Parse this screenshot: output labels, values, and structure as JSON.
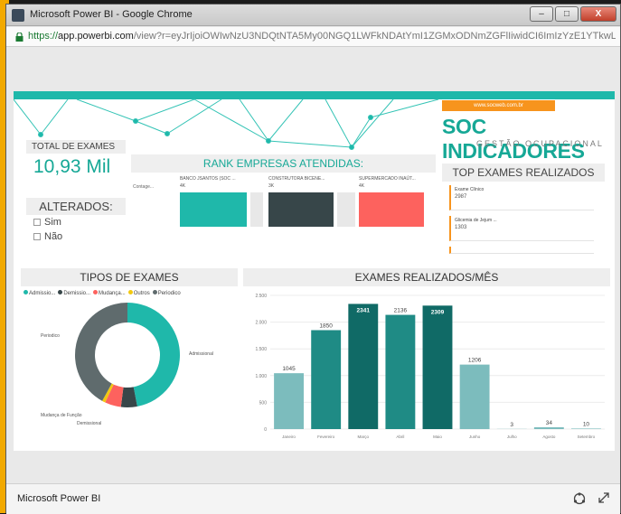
{
  "window": {
    "title": "Microsoft Power BI - Google Chrome",
    "min": "–",
    "max": "□",
    "close": "X"
  },
  "address": {
    "scheme": "https://",
    "host": "app.powerbi.com",
    "rest": "/view?r=eyJrIjoiOWIwNzU3NDQtNTA5My00NGQ1LWFkNDAtYmI1ZGMxODNmZGFlIiwidCI6ImIzYzE1YTkwLTI"
  },
  "brand": {
    "logo_text": "www.socweb.com.br",
    "title": "SOC INDICADORES",
    "subtitle": "GESTÃO OCUPACIONAL"
  },
  "total_exames": {
    "label": "TOTAL DE EXAMES",
    "value": "10,93 Mil"
  },
  "alterados": {
    "label": "ALTERADOS:",
    "options": [
      "Sim",
      "Não"
    ]
  },
  "rank": {
    "title": "RANK EMPRESAS ATENDIDAS:",
    "row_label": "Contage...",
    "companies": [
      {
        "name": "BANCO JSANTOS (SOC ...",
        "value": "4K"
      },
      {
        "name": "CONSTRUTORA BICENE...",
        "value": "3K"
      },
      {
        "name": "SUPERMERCADO INAÚT...",
        "value": "4K"
      }
    ]
  },
  "top_exames": {
    "title": "TOP EXAMES REALIZADOS",
    "items": [
      {
        "name": "Exame Clínico",
        "count": "2987"
      },
      {
        "name": "Glicemia de Jejum ...",
        "count": "1303"
      }
    ]
  },
  "tipos": {
    "title": "TIPOS DE EXAMES",
    "legend": [
      {
        "label": "Admissio...",
        "color": "#1fb8aa"
      },
      {
        "label": "Demissio...",
        "color": "#374649"
      },
      {
        "label": "Mudança...",
        "color": "#fd625e"
      },
      {
        "label": "Outros",
        "color": "#f2c80f"
      },
      {
        "label": "Periodico",
        "color": "#5f6b6d"
      }
    ],
    "slice_labels": {
      "admissional": "Admissional",
      "periodico": "Periodico",
      "mudanca": "Mudança de Função",
      "demissional": "Demissional"
    }
  },
  "chart_data": [
    {
      "type": "pie",
      "title": "TIPOS DE EXAMES",
      "categories": [
        "Admissional",
        "Demissional",
        "Mudança de Função",
        "Outros",
        "Periodico"
      ],
      "values": [
        47,
        5,
        5,
        1,
        42
      ],
      "colors": [
        "#1fb8aa",
        "#374649",
        "#fd625e",
        "#f2c80f",
        "#5f6b6d"
      ]
    },
    {
      "type": "bar",
      "title": "EXAMES REALIZADOS/MÊS",
      "categories": [
        "Janeiro",
        "Fevereiro",
        "Março",
        "Abril",
        "Maio",
        "Junho",
        "Julho",
        "Agosto",
        "Setembro"
      ],
      "values": [
        1045,
        1850,
        2341,
        2136,
        2309,
        1206,
        3,
        34,
        10
      ],
      "value_labels": [
        "1045",
        "1850",
        "2341",
        "2136",
        "2309",
        "1206",
        "3",
        "34",
        "10"
      ],
      "colors": [
        "#7cbcbd",
        "#1f8b85",
        "#106a66",
        "#1f8b85",
        "#106a66",
        "#7cbcbd",
        "#7cbcbd",
        "#7cbcbd",
        "#7cbcbd"
      ],
      "ylim": [
        0,
        2500
      ],
      "yticks": [
        "0",
        "500",
        "1.000",
        "1.500",
        "2.000",
        "2.500"
      ],
      "grid": true
    }
  ],
  "footer": {
    "title": "Microsoft Power BI"
  }
}
